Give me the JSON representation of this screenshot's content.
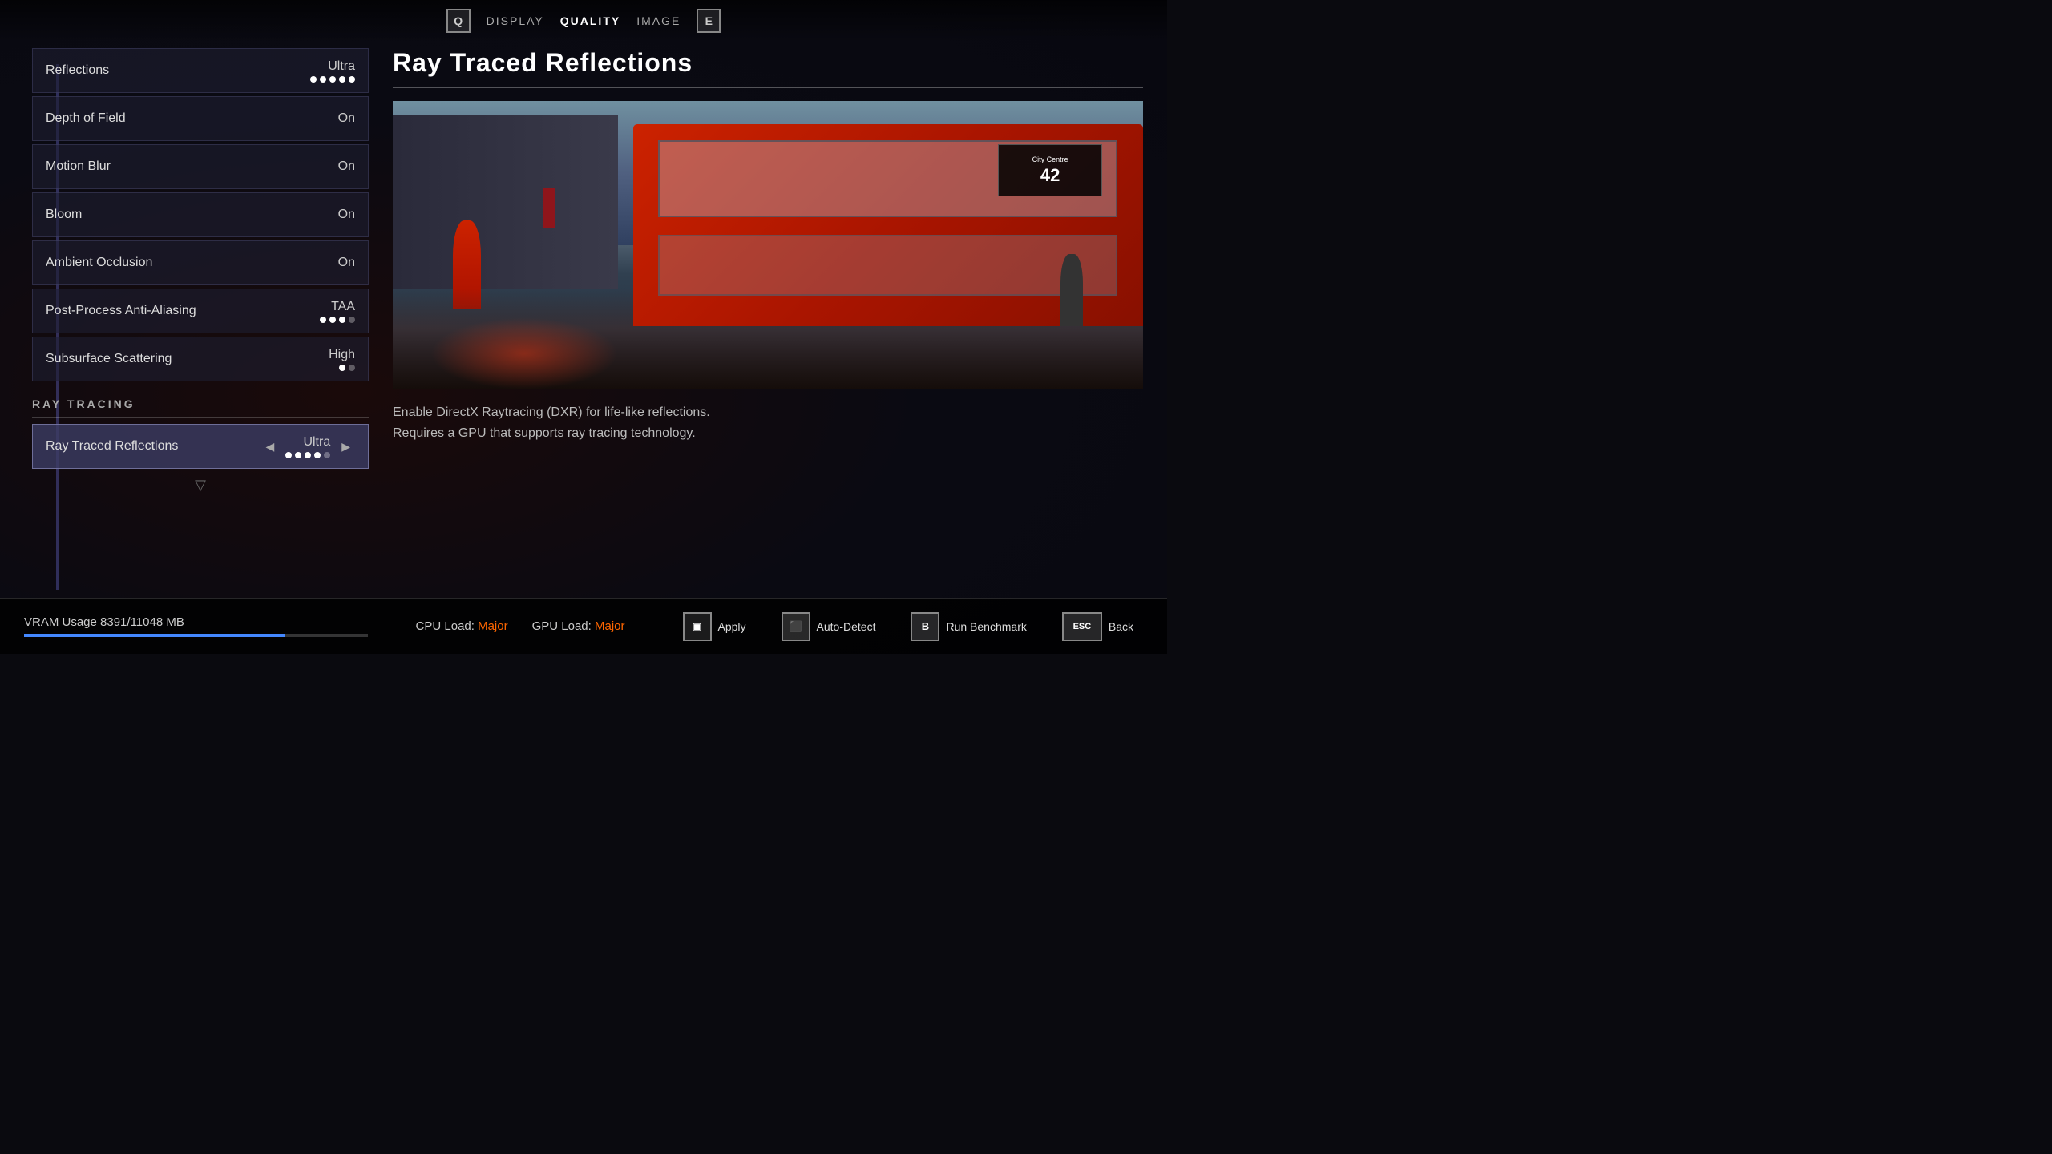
{
  "nav": {
    "left_key": "Q",
    "right_key": "E",
    "tabs": [
      {
        "id": "display",
        "label": "DISPLAY",
        "active": false
      },
      {
        "id": "quality",
        "label": "QUALITY",
        "active": true
      },
      {
        "id": "image",
        "label": "IMAGE",
        "active": false
      }
    ]
  },
  "settings": [
    {
      "id": "reflections",
      "name": "Reflections",
      "value": "Ultra",
      "dots": [
        true,
        true,
        true,
        true,
        true
      ],
      "has_slider": true
    },
    {
      "id": "depth_of_field",
      "name": "Depth of Field",
      "value": "On",
      "dots": [],
      "has_slider": false
    },
    {
      "id": "motion_blur",
      "name": "Motion Blur",
      "value": "On",
      "dots": [],
      "has_slider": false
    },
    {
      "id": "bloom",
      "name": "Bloom",
      "value": "On",
      "dots": [],
      "has_slider": false
    },
    {
      "id": "ambient_occlusion",
      "name": "Ambient Occlusion",
      "value": "On",
      "dots": [],
      "has_slider": false
    },
    {
      "id": "post_process_aa",
      "name": "Post-Process Anti-Aliasing",
      "value": "TAA",
      "dots": [
        true,
        true,
        true,
        false
      ],
      "has_slider": true
    },
    {
      "id": "subsurface_scattering",
      "name": "Subsurface Scattering",
      "value": "High",
      "dots": [
        true,
        false
      ],
      "has_slider": true
    }
  ],
  "ray_tracing_section": {
    "label": "RAY TRACING",
    "items": [
      {
        "id": "ray_traced_reflections",
        "name": "Ray Traced Reflections",
        "value": "Ultra",
        "dots": [
          true,
          true,
          true,
          true,
          false
        ],
        "has_slider": true,
        "selected": true,
        "has_arrows": true
      }
    ]
  },
  "detail_panel": {
    "title": "Ray Traced Reflections",
    "description": "Enable DirectX Raytracing (DXR) for life-like reflections.\nRequires a GPU that supports ray tracing technology."
  },
  "stats": {
    "vram_label": "VRAM Usage 8391/11048 MB",
    "vram_fill_percent": 76,
    "cpu_load_label": "CPU Load:",
    "cpu_load_value": "Major",
    "gpu_load_label": "GPU Load:",
    "gpu_load_value": "Major"
  },
  "action_buttons": [
    {
      "id": "apply",
      "key": "▣",
      "label": "Apply"
    },
    {
      "id": "auto_detect",
      "key": "⬛",
      "label": "Auto-Detect"
    },
    {
      "id": "run_benchmark",
      "key": "B",
      "label": "Run Benchmark"
    },
    {
      "id": "back",
      "key": "ESC",
      "label": "Back"
    }
  ],
  "scene": {
    "bus_number": "42",
    "bus_destination": "City Centre"
  }
}
